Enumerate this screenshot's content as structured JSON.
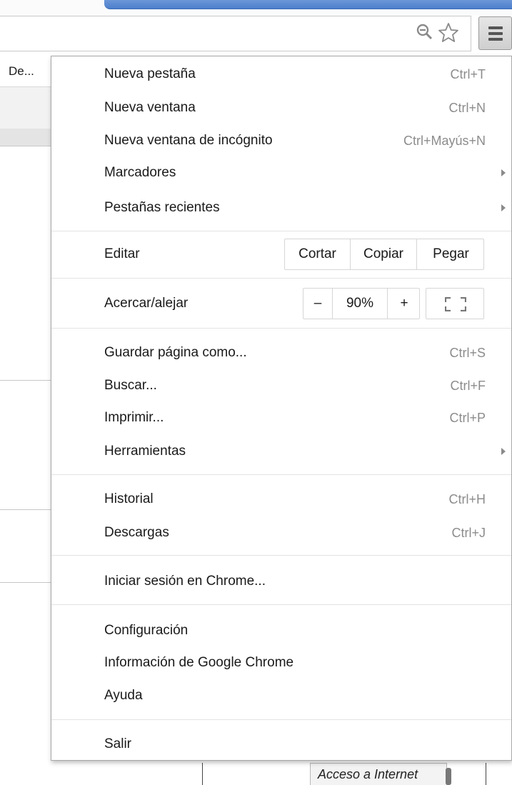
{
  "toolbar": {
    "zoom_icon": "magnifier-minus-icon",
    "star_icon": "bookmark-star-icon",
    "menu_icon": "hamburger-menu-icon"
  },
  "background": {
    "tab_label": "De...",
    "status_text": "Acceso a Internet"
  },
  "menu": {
    "group1": [
      {
        "label": "Nueva pestaña",
        "shortcut": "Ctrl+T"
      },
      {
        "label": "Nueva ventana",
        "shortcut": "Ctrl+N"
      },
      {
        "label": "Nueva ventana de incógnito",
        "shortcut": "Ctrl+Mayús+N"
      },
      {
        "label": "Marcadores",
        "submenu": true
      },
      {
        "label": "Pestañas recientes",
        "submenu": true
      }
    ],
    "edit": {
      "label": "Editar",
      "cut": "Cortar",
      "copy": "Copiar",
      "paste": "Pegar"
    },
    "zoom": {
      "label": "Acercar/alejar",
      "minus": "–",
      "value": "90%",
      "plus": "+",
      "fullscreen_icon": "fullscreen-icon"
    },
    "group2": [
      {
        "label": "Guardar página como...",
        "shortcut": "Ctrl+S"
      },
      {
        "label": "Buscar...",
        "shortcut": "Ctrl+F"
      },
      {
        "label": "Imprimir...",
        "shortcut": "Ctrl+P"
      },
      {
        "label": "Herramientas",
        "submenu": true
      }
    ],
    "group3": [
      {
        "label": "Historial",
        "shortcut": "Ctrl+H"
      },
      {
        "label": "Descargas",
        "shortcut": "Ctrl+J"
      }
    ],
    "signin": {
      "label": "Iniciar sesión en Chrome..."
    },
    "group4": [
      {
        "label": "Configuración"
      },
      {
        "label": "Información de Google Chrome"
      },
      {
        "label": "Ayuda"
      }
    ],
    "exit": {
      "label": "Salir"
    }
  }
}
